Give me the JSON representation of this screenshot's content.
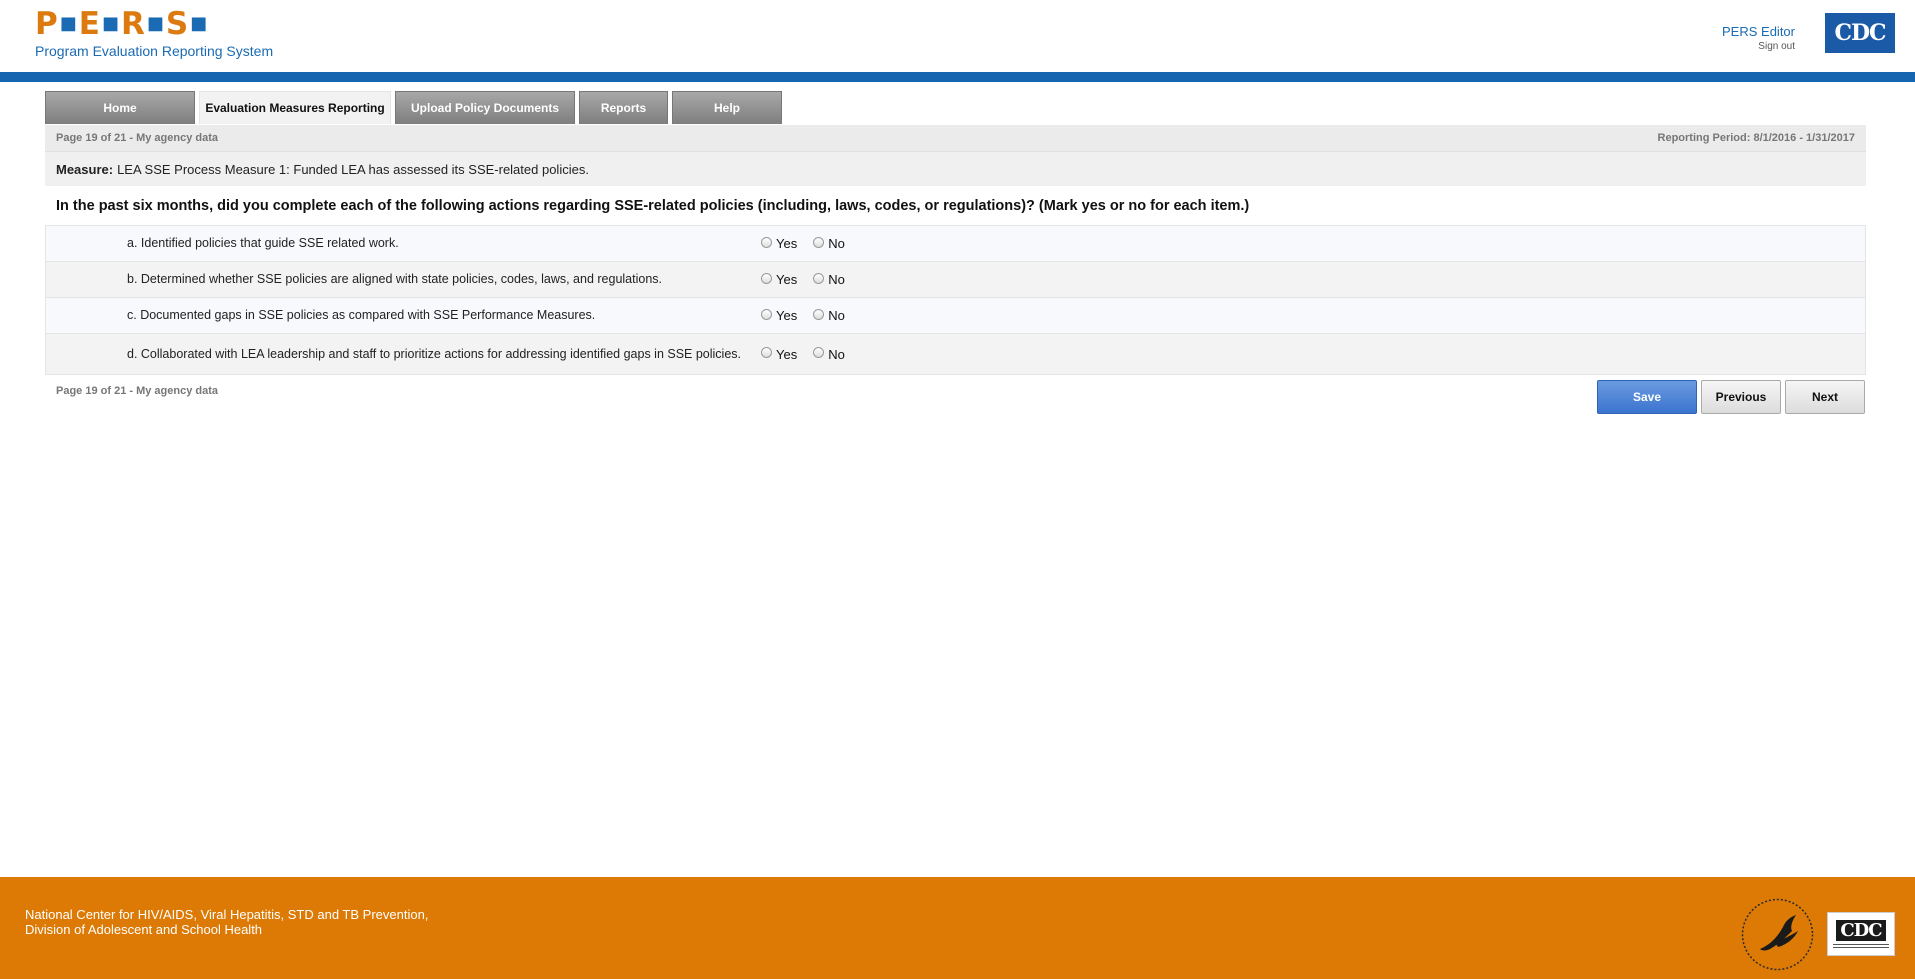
{
  "header": {
    "logo_letters": [
      "P",
      "E",
      "R",
      "S"
    ],
    "logo_subtitle": "Program Evaluation Reporting System",
    "user_name": "PERS Editor",
    "sign_out": "Sign out",
    "cdc_logo_text": "CDC"
  },
  "tabs": [
    {
      "label": "Home",
      "active": false
    },
    {
      "label": "Evaluation Measures Reporting",
      "active": true
    },
    {
      "label": "Upload Policy Documents",
      "active": false
    },
    {
      "label": "Reports",
      "active": false
    },
    {
      "label": "Help",
      "active": false
    }
  ],
  "panel": {
    "page_info": "Page 19 of 21 - My agency data",
    "reporting_period": "Reporting Period: 8/1/2016 - 1/31/2017",
    "measure_label": "Measure:",
    "measure_text": "LEA SSE Process Measure 1: Funded LEA has assessed its SSE-related policies.",
    "question": "In the past six months, did you complete each of the following actions regarding SSE-related policies (including, laws, codes, or regulations)? (Mark yes or no for each item.)",
    "items": [
      {
        "text": "a. Identified policies that guide SSE related work."
      },
      {
        "text": "b. Determined whether SSE policies are aligned with state policies, codes, laws, and regulations."
      },
      {
        "text": "c. Documented gaps in SSE policies as compared with SSE Performance Measures."
      },
      {
        "text": "d. Collaborated with LEA leadership and staff to prioritize actions for addressing identified gaps in SSE policies."
      }
    ],
    "yes_label": "Yes",
    "no_label": "No",
    "bottom_page_info": "Page 19 of 21 - My agency data",
    "save_label": "Save",
    "previous_label": "Previous",
    "next_label": "Next"
  },
  "footer": {
    "line1": "National Center for HIV/AIDS, Viral Hepatitis, STD and TB Prevention,",
    "line2": "Division of Adolescent and School Health",
    "cdc_logo_text": "CDC"
  },
  "colors": {
    "brand_orange": "#dc7a05",
    "brand_blue": "#1565b0",
    "save_blue": "#3b74cf"
  }
}
